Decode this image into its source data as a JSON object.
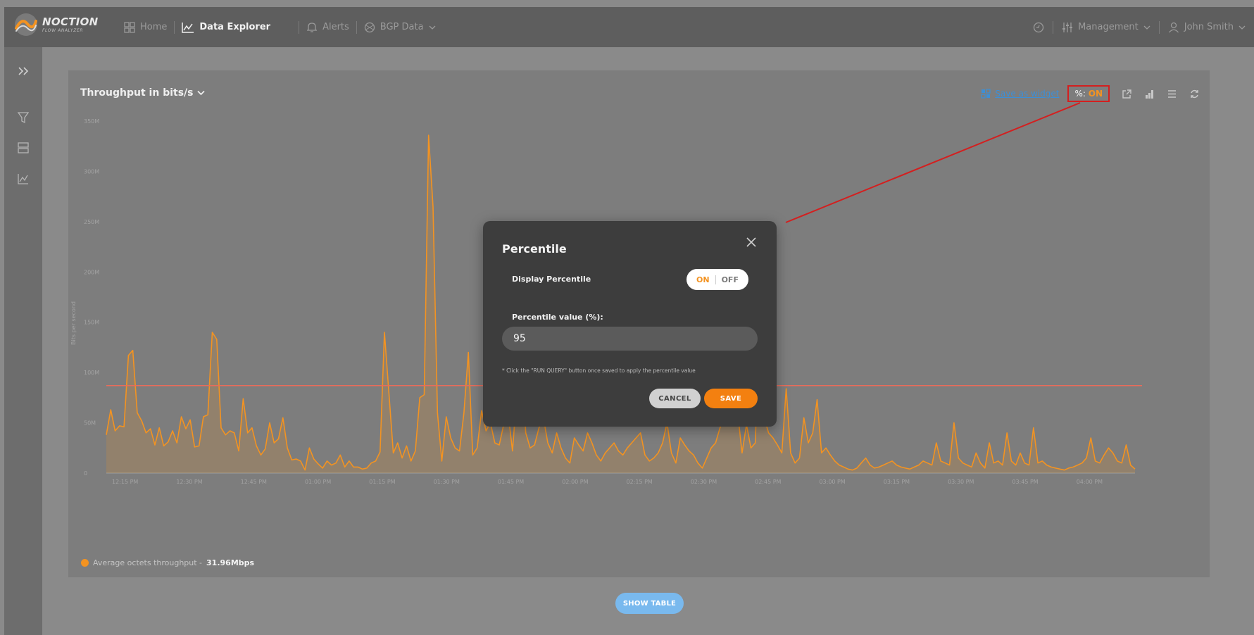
{
  "app": {
    "logo_name": "NOCTION",
    "logo_sub": "FLOW ANALYZER"
  },
  "nav": [
    {
      "label": "Home",
      "icon": "grid-icon"
    },
    {
      "label": "Data Explorer",
      "icon": "chart-line-icon",
      "active": true
    },
    {
      "label": "Alerts",
      "icon": "bell-icon"
    },
    {
      "label": "BGP Data",
      "icon": "globe-icon"
    }
  ],
  "right_nav": {
    "management": "Management",
    "user": "John Smith"
  },
  "panel": {
    "title": "Throughput in bits/s",
    "save_widget": "Save as widget",
    "pct_prefix": "%:",
    "pct_state": "ON",
    "legend_label": "Average octets throughput - ",
    "legend_value": "31.96Mbps"
  },
  "chart_data": {
    "type": "area",
    "ylabel": "Bits per second",
    "y_ticks": [
      "0",
      "50M",
      "100M",
      "150M",
      "200M",
      "250M",
      "300M",
      "350M"
    ],
    "ylim": [
      0,
      350000000
    ],
    "x_ticks": [
      "12:15 PM",
      "12:30 PM",
      "12:45 PM",
      "01:00 PM",
      "01:15 PM",
      "01:30 PM",
      "01:45 PM",
      "02:00 PM",
      "02:15 PM",
      "02:30 PM",
      "02:45 PM",
      "03:00 PM",
      "03:15 PM",
      "03:30 PM",
      "03:45 PM",
      "04:00 PM"
    ],
    "series": [
      {
        "color": "#f39321",
        "values": [
          38,
          63,
          42,
          47,
          46,
          117,
          122,
          60,
          52,
          40,
          44,
          28,
          45,
          27,
          31,
          42,
          30,
          56,
          44,
          53,
          26,
          27,
          56,
          58,
          140,
          133,
          45,
          38,
          42,
          40,
          22,
          74,
          40,
          45,
          27,
          18,
          24,
          50,
          30,
          34,
          55,
          25,
          13,
          14,
          12,
          3,
          25,
          14,
          9,
          5,
          12,
          8,
          10,
          18,
          6,
          12,
          6,
          6,
          4,
          5,
          10,
          12,
          21,
          140,
          80,
          20,
          30,
          15,
          27,
          12,
          22,
          75,
          78,
          336,
          265,
          60,
          12,
          56,
          35,
          25,
          22,
          60,
          120,
          18,
          25,
          62,
          42,
          50,
          30,
          28,
          48,
          60,
          22,
          80,
          120,
          40,
          25,
          28,
          45,
          55,
          30,
          20,
          40,
          25,
          15,
          10,
          35,
          28,
          22,
          40,
          30,
          18,
          12,
          20,
          25,
          30,
          22,
          18,
          25,
          30,
          35,
          40,
          18,
          12,
          15,
          20,
          30,
          50,
          20,
          10,
          35,
          28,
          22,
          18,
          10,
          5,
          15,
          25,
          30,
          45,
          55,
          80,
          97,
          60,
          20,
          48,
          25,
          30,
          160,
          55,
          40,
          35,
          28,
          20,
          84,
          20,
          10,
          15,
          55,
          30,
          40,
          73,
          20,
          25,
          18,
          12,
          8,
          6,
          4,
          3,
          5,
          10,
          15,
          8,
          5,
          6,
          8,
          10,
          12,
          8,
          6,
          5,
          4,
          6,
          8,
          12,
          10,
          8,
          30,
          12,
          10,
          8,
          50,
          15,
          10,
          8,
          6,
          20,
          10,
          5,
          30,
          10,
          12,
          8,
          40,
          12,
          8,
          20,
          10,
          8,
          45,
          10,
          12,
          8,
          6,
          5,
          4,
          3,
          5,
          6,
          8,
          10,
          15,
          35,
          12,
          10,
          18,
          25,
          20,
          12,
          10,
          28,
          8,
          4
        ]
      }
    ],
    "percentile_line": 87000000
  },
  "modal": {
    "title": "Percentile",
    "display_label": "Display Percentile",
    "switch_on": "ON",
    "switch_off": "OFF",
    "value_label": "Percentile value (%):",
    "value": "95",
    "note": "* Click the \"RUN QUERY\" button once saved to apply the percentile value",
    "cancel": "CANCEL",
    "save": "SAVE"
  },
  "show_table": "SHOW TABLE"
}
